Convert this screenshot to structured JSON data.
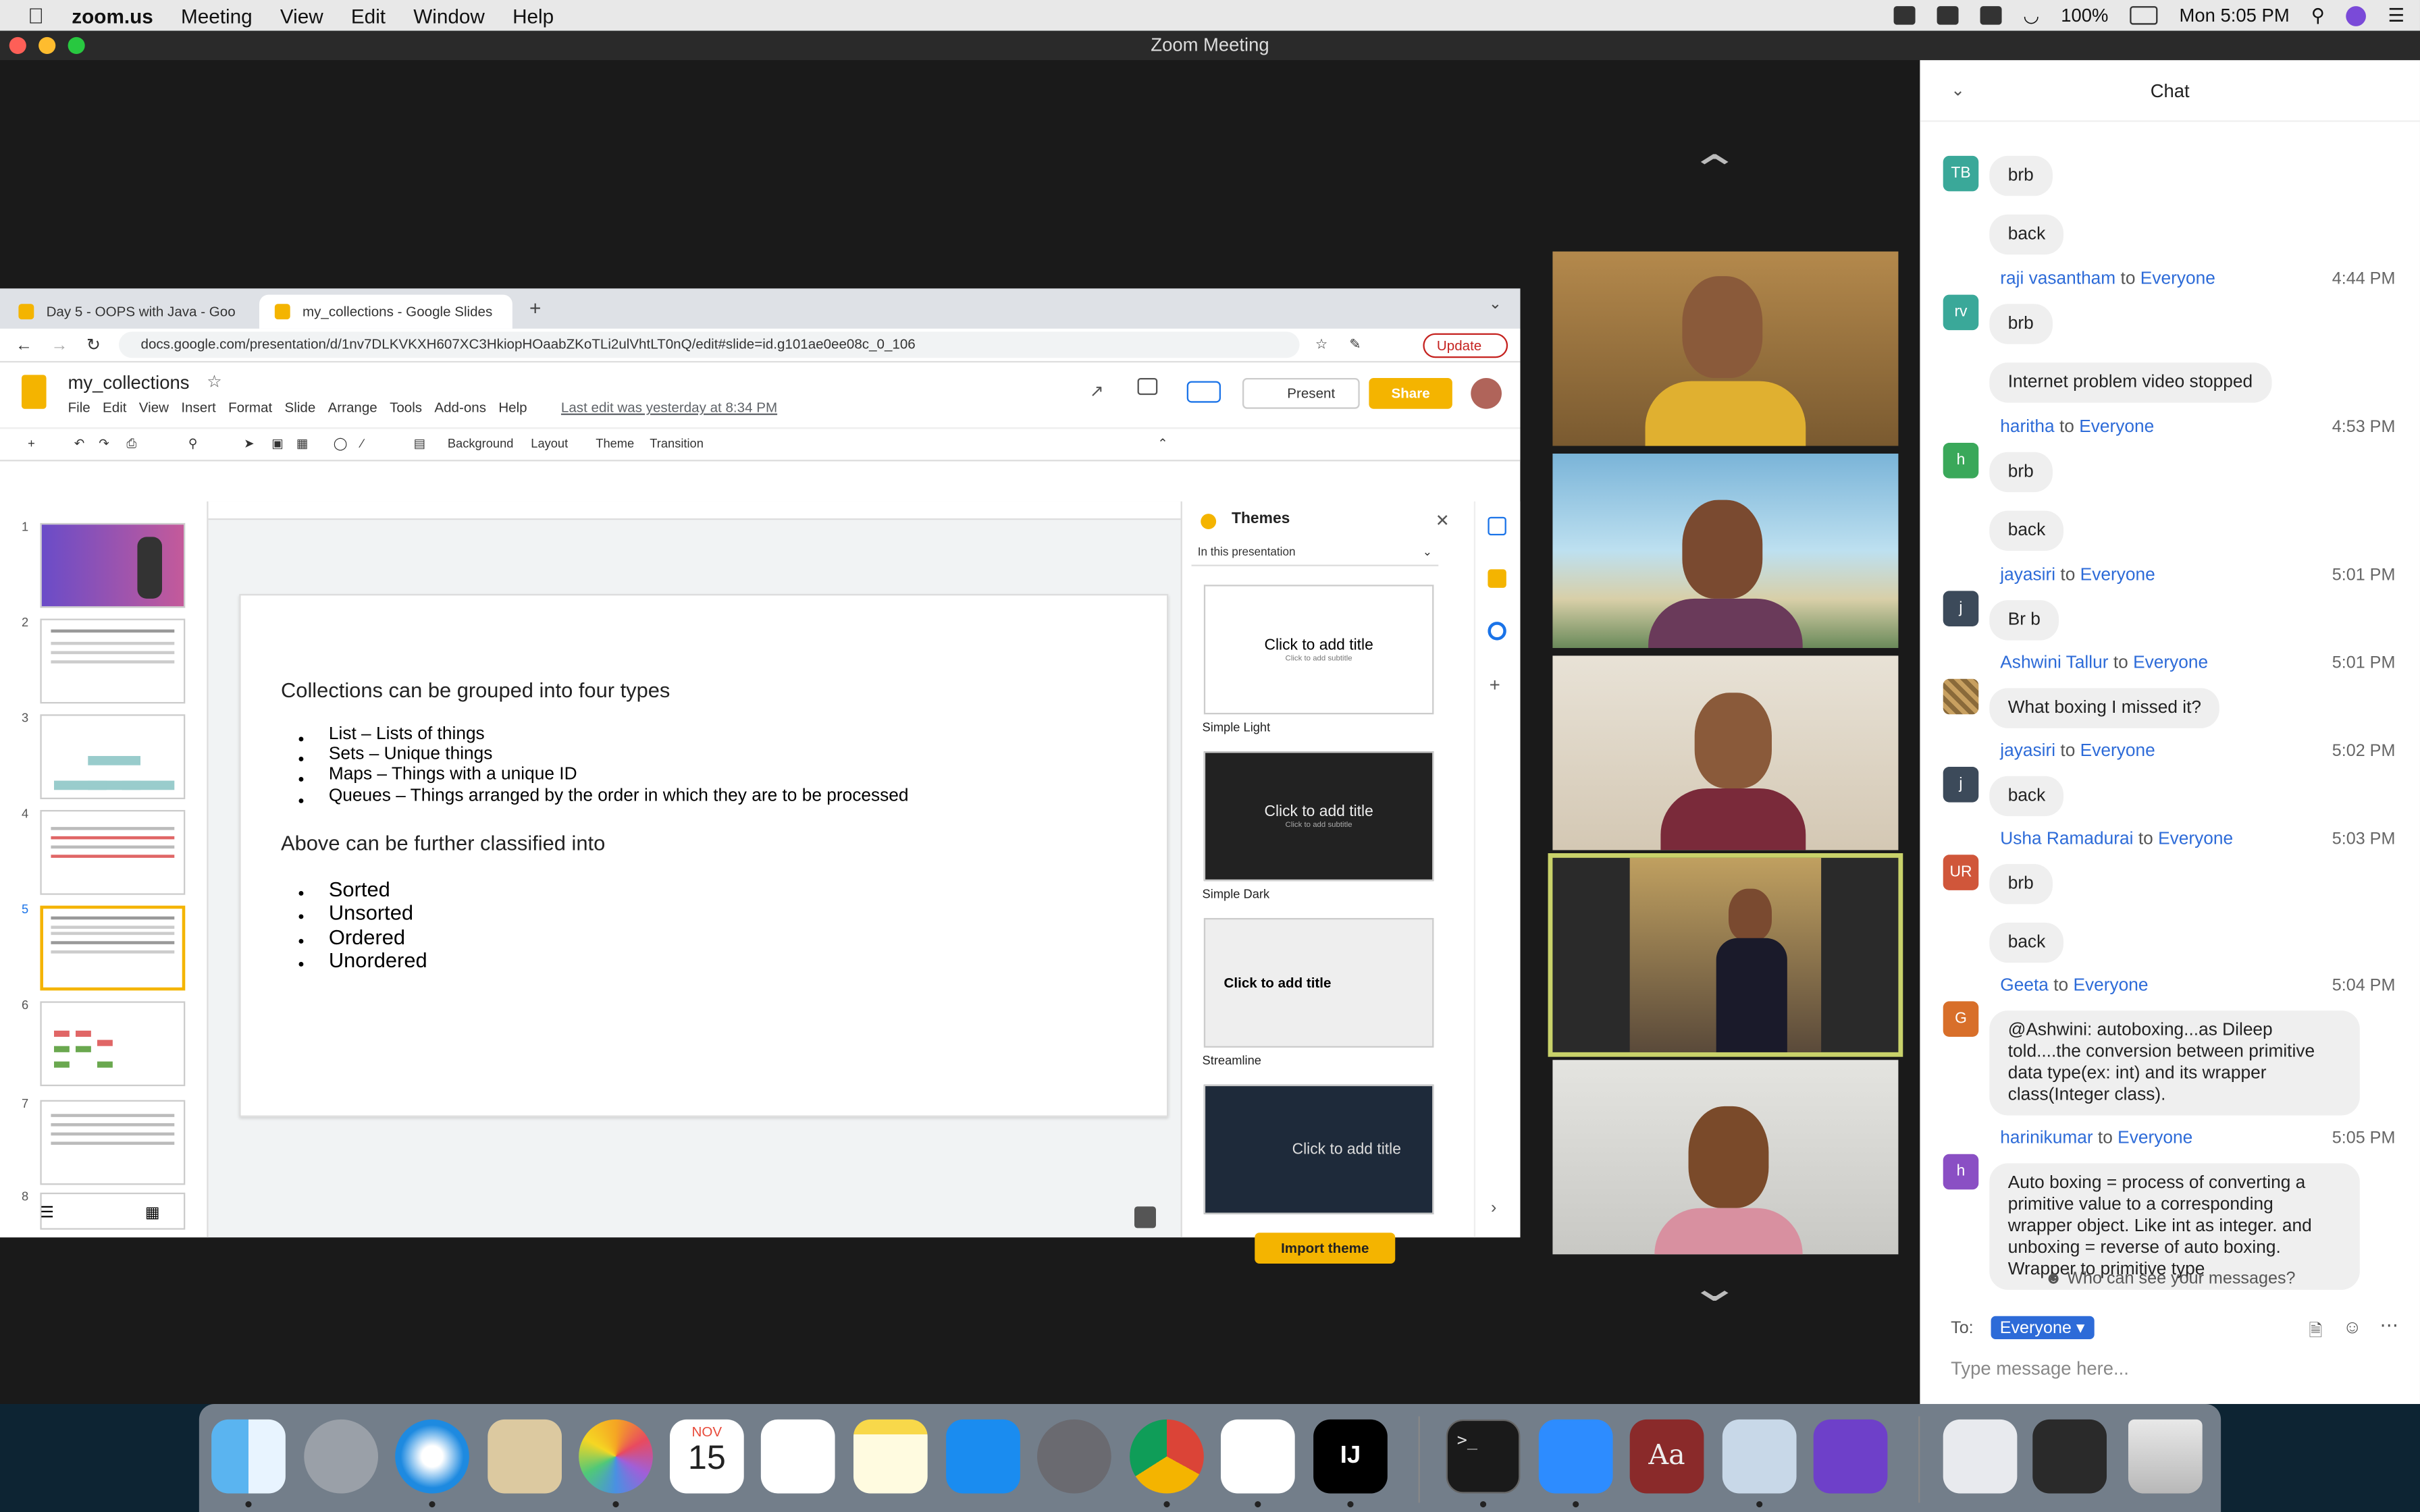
{
  "menubar": {
    "app": "zoom.us",
    "items": [
      "Meeting",
      "View",
      "Edit",
      "Window",
      "Help"
    ],
    "battery": "100%",
    "clock": "Mon 5:05 PM"
  },
  "window": {
    "title": "Zoom Meeting"
  },
  "browser": {
    "tabs": [
      {
        "label": "Day 5 - OOPS with Java - Goo"
      },
      {
        "label": "my_collections - Google Slides"
      }
    ],
    "url": "docs.google.com/presentation/d/1nv7DLKVKXH607XC3HkiopHOaabZKoTLi2ulVhtLT0nQ/edit#slide=id.g101ae0ee08c_0_106",
    "update_label": "Update"
  },
  "slides_app": {
    "doc_title": "my_collections",
    "menu": [
      "File",
      "Edit",
      "View",
      "Insert",
      "Format",
      "Slide",
      "Arrange",
      "Tools",
      "Add-ons",
      "Help"
    ],
    "last_edit": "Last edit was yesterday at 8:34 PM",
    "present_label": "Present",
    "share_label": "Share",
    "toolbar": {
      "background": "Background",
      "layout": "Layout",
      "theme": "Theme",
      "transition": "Transition"
    },
    "slide_numbers": [
      "1",
      "2",
      "3",
      "4",
      "5",
      "6",
      "7",
      "8"
    ],
    "slide": {
      "heading1": "Collections can be grouped into four types",
      "list1": [
        "List – Lists of things",
        "Sets – Unique things",
        "Maps – Things with a unique ID",
        "Queues – Things arranged by the order in which they are to be processed"
      ],
      "heading2": "Above can be further classified into",
      "list2": [
        "Sorted",
        "Unsorted",
        "Ordered",
        "Unordered"
      ]
    },
    "themes": {
      "title": "Themes",
      "scope": "In this presentation",
      "cards": [
        {
          "name": "Simple Light",
          "title": "Click to add title",
          "subtitle": "Click to add subtitle"
        },
        {
          "name": "Simple Dark",
          "title": "Click to add title",
          "subtitle": "Click to add subtitle"
        },
        {
          "name": "Streamline",
          "title": "Click to add title",
          "subtitle": ""
        },
        {
          "name": "",
          "title": "Click to add title",
          "subtitle": ""
        }
      ],
      "import_label": "Import theme"
    }
  },
  "chat": {
    "title": "Chat",
    "messages": [
      {
        "initials": "TB",
        "color": "#3aa899",
        "sender": "",
        "to": "",
        "time": "",
        "bubbles": [
          "brb",
          "back"
        ]
      },
      {
        "initials": "rv",
        "color": "#3aa899",
        "sender": "raji vasantham",
        "to": "Everyone",
        "time": "4:44 PM",
        "bubbles": [
          "brb",
          "Internet problem video stopped"
        ]
      },
      {
        "initials": "h",
        "color": "#3aa85a",
        "sender": "haritha",
        "to": "Everyone",
        "time": "4:53 PM",
        "bubbles": [
          "brb",
          "back"
        ]
      },
      {
        "initials": "j",
        "color": "#3c4a5a",
        "sender": "jayasiri",
        "to": "Everyone",
        "time": "5:01 PM",
        "bubbles": [
          "Br b"
        ]
      },
      {
        "initials": "",
        "color": "#7a5a3a",
        "sender": "Ashwini Tallur",
        "to": "Everyone",
        "time": "5:01 PM",
        "bubbles": [
          "What boxing I missed it?"
        ]
      },
      {
        "initials": "j",
        "color": "#3c4a5a",
        "sender": "jayasiri",
        "to": "Everyone",
        "time": "5:02 PM",
        "bubbles": [
          "back"
        ]
      },
      {
        "initials": "UR",
        "color": "#d0563a",
        "sender": "Usha Ramadurai",
        "to": "Everyone",
        "time": "5:03 PM",
        "bubbles": [
          "brb",
          "back"
        ]
      },
      {
        "initials": "G",
        "color": "#d86f2a",
        "sender": "Geeta",
        "to": "Everyone",
        "time": "5:04 PM",
        "bubbles": [
          "@Ashwini: autoboxing...as Dileep told....the conversion between primitive data type(ex: int) and its wrapper class(Integer class)."
        ]
      },
      {
        "initials": "h",
        "color": "#8a4fc4",
        "sender": "harinikumar",
        "to": "Everyone",
        "time": "5:05 PM",
        "bubbles": [
          "Auto boxing = process of converting a primitive value to a corresponding wrapper object. Like int as integer. and unboxing = reverse of auto boxing. Wrapper to primitive type"
        ]
      }
    ],
    "to_word": "to",
    "who_can_see": "Who can see your messages?",
    "to_label": "To:",
    "recipient": "Everyone",
    "input_placeholder": "Type message here..."
  },
  "dock": {
    "calendar_month": "NOV",
    "calendar_day": "15"
  }
}
